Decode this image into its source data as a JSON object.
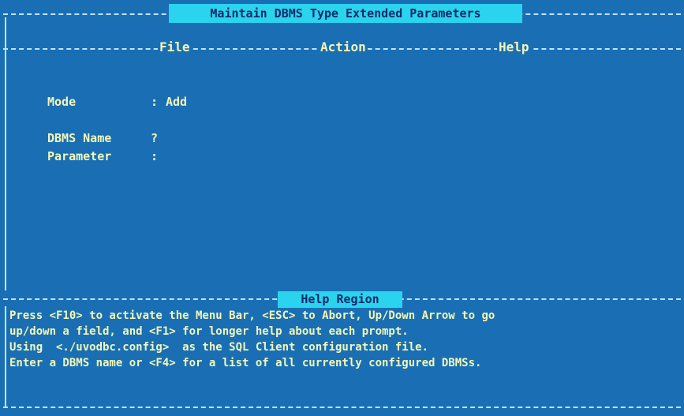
{
  "window": {
    "title": "Maintain DBMS Type Extended Parameters"
  },
  "menu": {
    "file": "File",
    "action": "Action",
    "help": "Help"
  },
  "form": {
    "mode": {
      "label": "Mode",
      "separator": ":",
      "value": "Add"
    },
    "dbms_name": {
      "label": "DBMS Name",
      "separator": "?",
      "value": ""
    },
    "parameter": {
      "label": "Parameter",
      "separator": ":",
      "value": ""
    }
  },
  "help": {
    "title": "Help Region",
    "lines": [
      "Press <F10> to activate the Menu Bar, <ESC> to Abort, Up/Down Arrow to go",
      "up/down a field, and <F1> for longer help about each prompt.",
      "Using  <./uvodbc.config>  as the SQL Client configuration file.",
      "Enter a DBMS name or <F4> for a list of all currently configured DBMSs."
    ]
  },
  "colors": {
    "background": "#1a6fb4",
    "highlight": "#2ad4ee",
    "text": "#f3f6b8",
    "border": "#bfe3ff"
  }
}
